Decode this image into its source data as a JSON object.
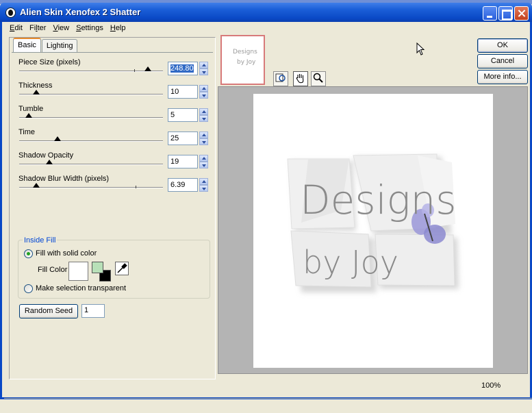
{
  "window": {
    "title": "Alien Skin Xenofex 2 Shatter"
  },
  "menu": [
    {
      "pre": "",
      "u": "E",
      "post": "dit"
    },
    {
      "pre": "Fi",
      "u": "l",
      "post": "ter"
    },
    {
      "pre": "",
      "u": "V",
      "post": "iew"
    },
    {
      "pre": "",
      "u": "S",
      "post": "ettings"
    },
    {
      "pre": "",
      "u": "H",
      "post": "elp"
    }
  ],
  "tabs": {
    "basic": "Basic",
    "lighting": "Lighting"
  },
  "params": {
    "piece_size": {
      "label": "Piece Size (pixels)",
      "value": "248.80"
    },
    "thickness": {
      "label": "Thickness",
      "value": "10"
    },
    "tumble": {
      "label": "Tumble",
      "value": "5"
    },
    "time": {
      "label": "Time",
      "value": "25"
    },
    "shadow_opacity": {
      "label": "Shadow Opacity",
      "value": "19"
    },
    "shadow_blur": {
      "label": "Shadow Blur Width (pixels)",
      "value": "6.39"
    }
  },
  "inside_fill": {
    "title": "Inside Fill",
    "solid_label": "Fill with solid color",
    "fill_color_label": "Fill Color",
    "transparent_label": "Make selection transparent",
    "fg_color": "#b8e0b8",
    "bg_color": "#000000"
  },
  "random_seed": {
    "button": "Random Seed",
    "value": "1"
  },
  "buttons": {
    "ok": "OK",
    "cancel": "Cancel",
    "more_info": "More info..."
  },
  "thumbnail": {
    "line1": "Designs",
    "line2": "by Joy"
  },
  "preview": {
    "line1": "Designs",
    "line2": "by Joy"
  },
  "status": {
    "zoom": "100%"
  },
  "icons": [
    "app-icon",
    "minimize-icon",
    "maximize-icon",
    "close-icon",
    "eyedropper-icon",
    "preview-toggle-icon",
    "hand-icon",
    "zoom-icon"
  ]
}
